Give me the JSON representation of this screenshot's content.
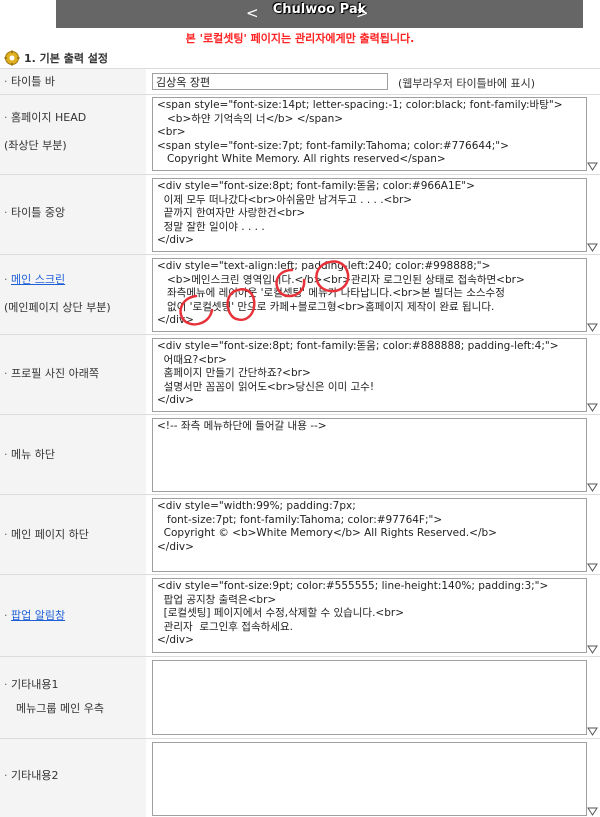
{
  "header": {
    "title": "Chulwoo Pak",
    "prev": "<",
    "next": ">"
  },
  "notice": "본 '로컬셋팅' 페이지는 관리자에게만 출력됩니다.",
  "section": {
    "label": "1. 기본 출력 설정",
    "icon": "gear-icon"
  },
  "rows": {
    "title_bar": {
      "label": "타이틀 바",
      "value": "김상옥 장편",
      "hint": "(웹부라우저 타이틀바에 표시)"
    },
    "homepage_head": {
      "label": "홈페이지 HEAD",
      "sublabel": "(좌상단 부분)",
      "content": "<span style=\"font-size:14pt; letter-spacing:-1; color:black; font-family:바탕\">\n   <b>하얀 기억속의 너</b> </span>\n<br>\n<span style=\"font-size:7pt; font-family:Tahoma; color:#776644;\">\n   Copyright White Memory. All rights reserved</span>"
    },
    "title_center": {
      "label": "타이틀 중앙",
      "content": "<div style=\"font-size:8pt; font-family:돋움; color:#966A1E\">\n  이제 모두 떠나갔다<br>아쉬움만 남겨두고 . . . .<br>\n  끝까지 한여자만 사랑한건<br>\n  정말 잘한 일이야 . . . .\n</div>"
    },
    "main_screen": {
      "label": "메인 스크린",
      "sublabel": "(메인페이지 상단 부분)",
      "content": "<div style=\"text-align:left; padding-left:240; color:#998888;\">\n   <b>메인스크린 영역입니다.</b><br>관리자 로그인된 상태로 접속하면<br>\n   좌측메뉴에 레이아웃 '로컬셋팅' 메뉴가 나타납니다.<br>본 빌더는 소스수정\n   없이 '로컬셋팅' 만으로 카페+블로그형<br>홈페이지 제작이 완료 됩니다.\n</div>"
    },
    "profile_below": {
      "label": "프로필 사진 아래쪽",
      "content": "<div style=\"font-size:8pt; font-family:돋움; color:#888888; padding-left:4;\">\n  어때요?<br>\n  홈페이지 만들기 간단하죠?<br>\n  설명서만 꼼꼼이 읽어도<br>당신은 이미 고수!\n</div>"
    },
    "menu_bottom": {
      "label": "메뉴 하단",
      "content": "<!-- 좌측 메뉴하단에 들어갈 내용 -->"
    },
    "main_page_bottom": {
      "label": "메인 페이지 하단",
      "content": "<div style=\"width:99%; padding:7px;\n   font-size:7pt; font-family:Tahoma; color:#97764F;\">\n  Copyright © <b>White Memory</b> All Rights Reserved.</b>\n</div>"
    },
    "popup": {
      "label": "팝업 알림창",
      "content": "<div style=\"font-size:9pt; color:#555555; line-height:140%; padding:3;\">\n  팝업 공지창 출력은<br>\n  [로컬셋팅] 페이지에서 수정,삭제할 수 있습니다.<br>\n  관리자  로그인후 접속하세요.\n</div>"
    },
    "etc1": {
      "label": "기타내용1",
      "sublabel": "메뉴그룹 메인 우측",
      "content": ""
    },
    "etc2": {
      "label": "기타내용2",
      "content": ""
    }
  },
  "colors": {
    "topbar": "#666666",
    "notice": "#ff2222",
    "link": "#1e5fd6",
    "label_bg": "#f4f4f4",
    "scribble": "#e8323a"
  }
}
